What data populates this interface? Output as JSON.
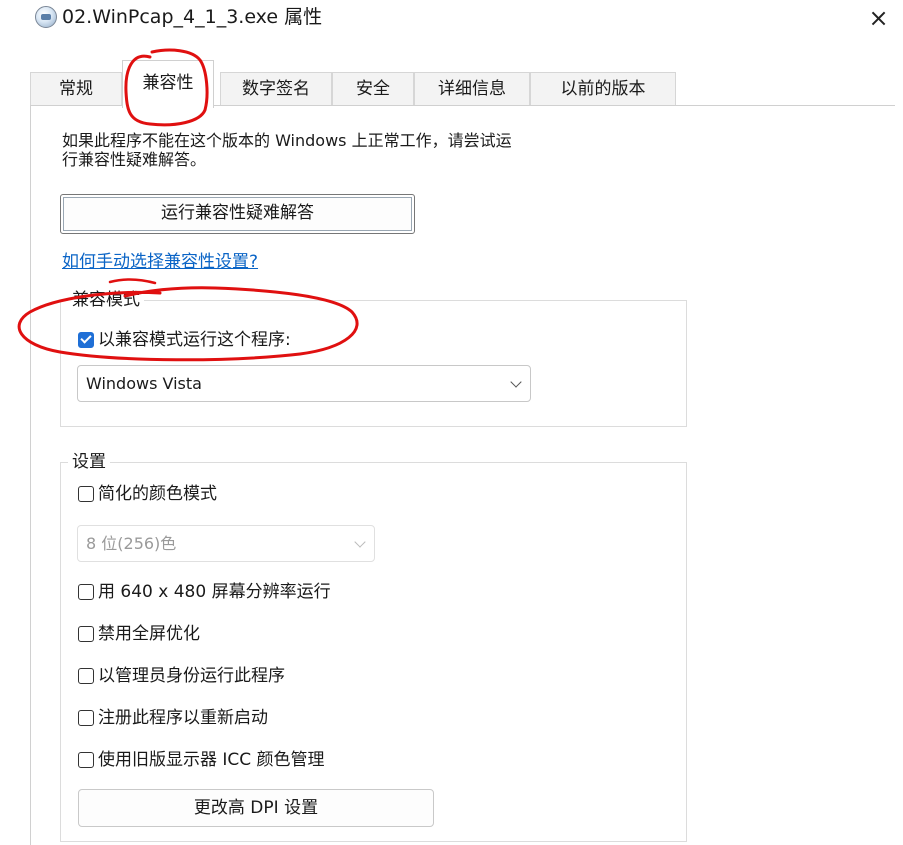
{
  "window": {
    "title": "02.WinPcap_4_1_3.exe 属性",
    "close_symbol": "×"
  },
  "tabs": [
    {
      "label": "常规",
      "active": false
    },
    {
      "label": "兼容性",
      "active": true
    },
    {
      "label": "数字签名",
      "active": false
    },
    {
      "label": "安全",
      "active": false
    },
    {
      "label": "详细信息",
      "active": false
    },
    {
      "label": "以前的版本",
      "active": false
    }
  ],
  "compat": {
    "description_line1": "如果此程序不能在这个版本的 Windows 上正常工作，请尝试运",
    "description_line2": "行兼容性疑难解答。",
    "troubleshoot_button": "运行兼容性疑难解答",
    "manual_link": "如何手动选择兼容性设置?",
    "mode_group": {
      "legend": "兼容模式",
      "checkbox_label": "以兼容模式运行这个程序:",
      "checked": true,
      "selected_os": "Windows Vista"
    },
    "settings_group": {
      "legend": "设置",
      "reduced_color": {
        "label": "简化的颜色模式",
        "checked": false
      },
      "color_select": "8 位(256)色",
      "options": [
        {
          "label": "用 640 x 480 屏幕分辨率运行",
          "checked": false
        },
        {
          "label": "禁用全屏优化",
          "checked": false
        },
        {
          "label": "以管理员身份运行此程序",
          "checked": false
        },
        {
          "label": "注册此程序以重新启动",
          "checked": false
        },
        {
          "label": "使用旧版显示器 ICC 颜色管理",
          "checked": false
        }
      ],
      "dpi_button": "更改高 DPI 设置"
    }
  },
  "annotation_color": "#e01010"
}
